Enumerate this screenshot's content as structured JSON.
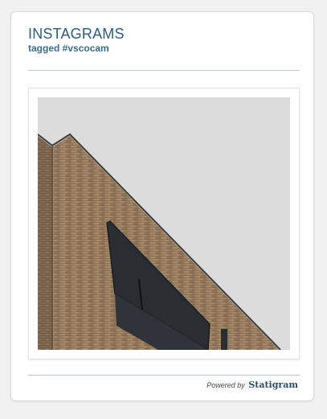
{
  "widget": {
    "title": "INSTAGRAMS",
    "subtitle": "tagged #vscocam"
  },
  "photos": [
    {
      "subject_icon": "brick-building-corner-photo",
      "colors": {
        "sky": "#dcdcdc",
        "brick": "#9a7e60",
        "window": "#2a2e33",
        "roof_edge": "#3a3a3a"
      }
    }
  ],
  "footer": {
    "powered_prefix": "Powered by",
    "brand": "Statigram"
  },
  "colors": {
    "title": "#2d5d7a",
    "rule": "#b7c9d2",
    "background": "#f1f1f1"
  }
}
